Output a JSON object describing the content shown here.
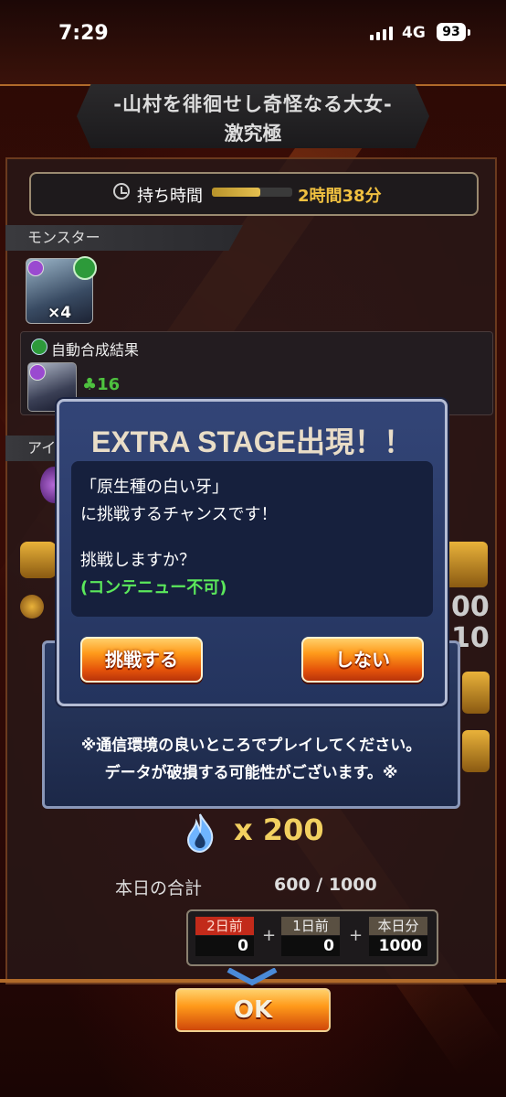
{
  "status_bar": {
    "time": "7:29",
    "network": "4G",
    "battery": "93"
  },
  "title": {
    "line1": "-山村を徘徊せし奇怪なる大女-",
    "line2": "激究極"
  },
  "hold_time": {
    "label": "持ち時間",
    "value": "2時間38分",
    "gauge_fraction": 0.6
  },
  "monster_section": {
    "header": "モンスター",
    "count": "×4"
  },
  "auto_synthesis": {
    "label": "自動合成結果",
    "clover_count": "16"
  },
  "items_header": "アイ",
  "background_numbers": [
    "00",
    "10"
  ],
  "extra_dialog": {
    "title": "EXTRA STAGE出現！！",
    "message_line1": "「原生種の白い牙」",
    "message_line2": "に挑戦するチャンスです！",
    "message_line3": "挑戦しますか？",
    "message_line4": "(コンテニュー不可)",
    "challenge_button": "挑戦する",
    "decline_button": "しない"
  },
  "notice": {
    "line1": "※通信環境の良いところでプレイしてください。",
    "line2": "データが破損する可能性がございます。※"
  },
  "reward": {
    "multiplier": "x 200"
  },
  "daily_total": {
    "label": "本日の合計",
    "value": "600 / 1000",
    "days": [
      {
        "label": "2日前",
        "value": "0"
      },
      {
        "label": "1日前",
        "value": "0"
      },
      {
        "label": "本日分",
        "value": "1000"
      }
    ],
    "plus": "+"
  },
  "ok_button": "OK",
  "colors": {
    "accent_orange": "#ff9a1a",
    "dialog_blue": "#2a3a62",
    "highlight_green": "#5be85b",
    "gold": "#f2d060"
  }
}
